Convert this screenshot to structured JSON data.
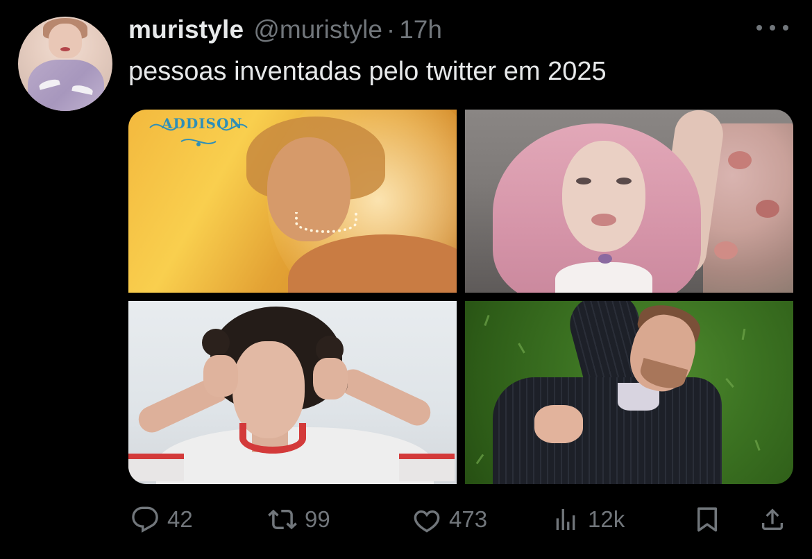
{
  "tweet": {
    "display_name": "muristyle",
    "handle": "@muristyle",
    "separator": "·",
    "time": "17h",
    "text": "pessoas inventadas pelo twitter em 2025"
  },
  "media": {
    "images": [
      {
        "name": "image-1",
        "overlay_text": "ADDISON"
      },
      {
        "name": "image-2"
      },
      {
        "name": "image-3"
      },
      {
        "name": "image-4"
      }
    ]
  },
  "actions": {
    "reply": {
      "icon": "reply-icon",
      "count": "42"
    },
    "repost": {
      "icon": "repost-icon",
      "count": "99"
    },
    "like": {
      "icon": "heart-icon",
      "count": "473"
    },
    "views": {
      "icon": "views-icon",
      "count": "12k"
    },
    "bookmark": {
      "icon": "bookmark-icon"
    },
    "share": {
      "icon": "share-icon"
    }
  },
  "colors": {
    "background": "#000000",
    "primary_text": "#e7e9ea",
    "secondary_text": "#71767b"
  }
}
